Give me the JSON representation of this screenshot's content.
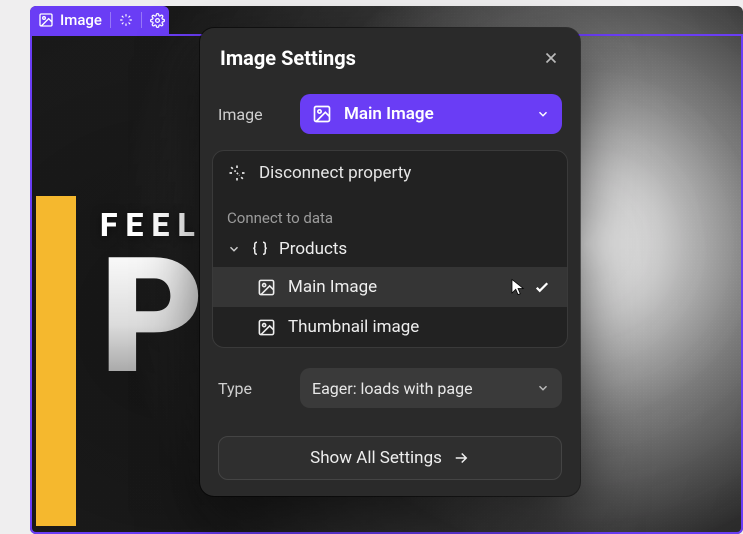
{
  "selection_tag": {
    "label": "Image"
  },
  "hero": {
    "line1": "FEEL",
    "line2": "PI"
  },
  "panel": {
    "title": "Image Settings",
    "image_row_label": "Image",
    "image_chip_value": "Main Image",
    "disconnect_label": "Disconnect property",
    "connect_header": "Connect to data",
    "collection_name": "Products",
    "fields": [
      {
        "label": "Main Image",
        "selected": true
      },
      {
        "label": "Thumbnail image",
        "selected": false
      }
    ],
    "type_row_label": "Type",
    "type_value": "Eager: loads with page",
    "show_all_label": "Show All Settings"
  },
  "colors": {
    "accent": "#6a3df5",
    "panel_bg": "#2a2a2a"
  }
}
